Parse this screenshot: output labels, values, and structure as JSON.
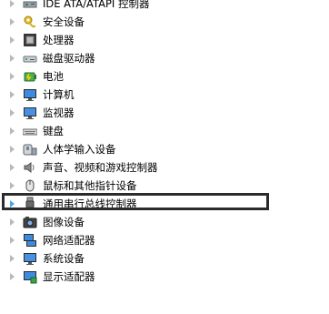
{
  "tree": {
    "items": [
      {
        "label": "IDE ATA/ATAPI 控制器",
        "icon": "ide-controller-icon"
      },
      {
        "label": "安全设备",
        "icon": "key-icon"
      },
      {
        "label": "处理器",
        "icon": "processor-chip-icon"
      },
      {
        "label": "磁盘驱动器",
        "icon": "disk-drive-icon"
      },
      {
        "label": "电池",
        "icon": "battery-icon"
      },
      {
        "label": "计算机",
        "icon": "computer-monitor-icon"
      },
      {
        "label": "监视器",
        "icon": "monitor-icon"
      },
      {
        "label": "键盘",
        "icon": "keyboard-icon"
      },
      {
        "label": "人体学输入设备",
        "icon": "human-interface-device-icon"
      },
      {
        "label": "声音、视频和游戏控制器",
        "icon": "speaker-icon"
      },
      {
        "label": "鼠标和其他指针设备",
        "icon": "mouse-icon"
      },
      {
        "label": "通用串行总线控制器",
        "icon": "usb-plug-icon",
        "selected": true
      },
      {
        "label": "图像设备",
        "icon": "camera-icon"
      },
      {
        "label": "网络适配器",
        "icon": "network-adapter-icon"
      },
      {
        "label": "系统设备",
        "icon": "system-device-icon"
      },
      {
        "label": "显示适配器",
        "icon": "display-adapter-icon"
      }
    ]
  },
  "colors": {
    "expander": "#b9b9b9",
    "expander_active": "#4aa3df",
    "highlight_border": "#2b2b2b"
  }
}
